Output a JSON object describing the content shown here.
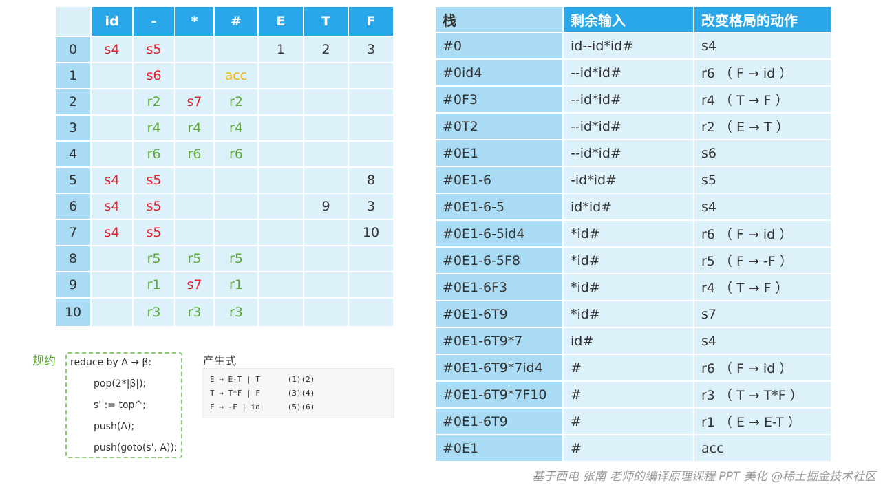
{
  "lr_table": {
    "headers": [
      "id",
      "-",
      "*",
      "#",
      "E",
      "T",
      "F"
    ],
    "rows": [
      {
        "state": "0",
        "cells": [
          {
            "t": "s4",
            "k": "s"
          },
          {
            "t": "s5",
            "k": "s"
          },
          {
            "t": "",
            "k": ""
          },
          {
            "t": "",
            "k": ""
          },
          {
            "t": "1",
            "k": "g"
          },
          {
            "t": "2",
            "k": "g"
          },
          {
            "t": "3",
            "k": "g"
          }
        ]
      },
      {
        "state": "1",
        "cells": [
          {
            "t": "",
            "k": ""
          },
          {
            "t": "s6",
            "k": "s"
          },
          {
            "t": "",
            "k": ""
          },
          {
            "t": "acc",
            "k": "a"
          },
          {
            "t": "",
            "k": ""
          },
          {
            "t": "",
            "k": ""
          },
          {
            "t": "",
            "k": ""
          }
        ]
      },
      {
        "state": "2",
        "cells": [
          {
            "t": "",
            "k": ""
          },
          {
            "t": "r2",
            "k": "r"
          },
          {
            "t": "s7",
            "k": "s"
          },
          {
            "t": "r2",
            "k": "r"
          },
          {
            "t": "",
            "k": ""
          },
          {
            "t": "",
            "k": ""
          },
          {
            "t": "",
            "k": ""
          }
        ]
      },
      {
        "state": "3",
        "cells": [
          {
            "t": "",
            "k": ""
          },
          {
            "t": "r4",
            "k": "r"
          },
          {
            "t": "r4",
            "k": "r"
          },
          {
            "t": "r4",
            "k": "r"
          },
          {
            "t": "",
            "k": ""
          },
          {
            "t": "",
            "k": ""
          },
          {
            "t": "",
            "k": ""
          }
        ]
      },
      {
        "state": "4",
        "cells": [
          {
            "t": "",
            "k": ""
          },
          {
            "t": "r6",
            "k": "r"
          },
          {
            "t": "r6",
            "k": "r"
          },
          {
            "t": "r6",
            "k": "r"
          },
          {
            "t": "",
            "k": ""
          },
          {
            "t": "",
            "k": ""
          },
          {
            "t": "",
            "k": ""
          }
        ]
      },
      {
        "state": "5",
        "cells": [
          {
            "t": "s4",
            "k": "s"
          },
          {
            "t": "s5",
            "k": "s"
          },
          {
            "t": "",
            "k": ""
          },
          {
            "t": "",
            "k": ""
          },
          {
            "t": "",
            "k": ""
          },
          {
            "t": "",
            "k": ""
          },
          {
            "t": "8",
            "k": "g"
          }
        ]
      },
      {
        "state": "6",
        "cells": [
          {
            "t": "s4",
            "k": "s"
          },
          {
            "t": "s5",
            "k": "s"
          },
          {
            "t": "",
            "k": ""
          },
          {
            "t": "",
            "k": ""
          },
          {
            "t": "",
            "k": ""
          },
          {
            "t": "9",
            "k": "g"
          },
          {
            "t": "3",
            "k": "g"
          }
        ]
      },
      {
        "state": "7",
        "cells": [
          {
            "t": "s4",
            "k": "s"
          },
          {
            "t": "s5",
            "k": "s"
          },
          {
            "t": "",
            "k": ""
          },
          {
            "t": "",
            "k": ""
          },
          {
            "t": "",
            "k": ""
          },
          {
            "t": "",
            "k": ""
          },
          {
            "t": "10",
            "k": "g"
          }
        ]
      },
      {
        "state": "8",
        "cells": [
          {
            "t": "",
            "k": ""
          },
          {
            "t": "r5",
            "k": "r"
          },
          {
            "t": "r5",
            "k": "r"
          },
          {
            "t": "r5",
            "k": "r"
          },
          {
            "t": "",
            "k": ""
          },
          {
            "t": "",
            "k": ""
          },
          {
            "t": "",
            "k": ""
          }
        ]
      },
      {
        "state": "9",
        "cells": [
          {
            "t": "",
            "k": ""
          },
          {
            "t": "r1",
            "k": "r"
          },
          {
            "t": "s7",
            "k": "s"
          },
          {
            "t": "r1",
            "k": "r"
          },
          {
            "t": "",
            "k": ""
          },
          {
            "t": "",
            "k": ""
          },
          {
            "t": "",
            "k": ""
          }
        ]
      },
      {
        "state": "10",
        "cells": [
          {
            "t": "",
            "k": ""
          },
          {
            "t": "r3",
            "k": "r"
          },
          {
            "t": "r3",
            "k": "r"
          },
          {
            "t": "r3",
            "k": "r"
          },
          {
            "t": "",
            "k": ""
          },
          {
            "t": "",
            "k": ""
          },
          {
            "t": "",
            "k": ""
          }
        ]
      }
    ]
  },
  "trace_table": {
    "headers": [
      "栈",
      "剩余输入",
      "改变格局的动作"
    ],
    "rows": [
      [
        "#0",
        "id--id*id#",
        "s4"
      ],
      [
        "#0id4",
        "--id*id#",
        "r6 （ F → id ）"
      ],
      [
        "#0F3",
        "--id*id#",
        "r4 （ T → F ）"
      ],
      [
        "#0T2",
        "--id*id#",
        "r2 （ E → T ）"
      ],
      [
        "#0E1",
        "--id*id#",
        "s6"
      ],
      [
        "#0E1-6",
        "-id*id#",
        "s5"
      ],
      [
        "#0E1-6-5",
        "id*id#",
        "s4"
      ],
      [
        "#0E1-6-5id4",
        "*id#",
        "r6 （ F → id ）"
      ],
      [
        "#0E1-6-5F8",
        "*id#",
        "r5 （ F → -F ）"
      ],
      [
        "#0E1-6F3",
        "*id#",
        "r4 （ T → F ）"
      ],
      [
        "#0E1-6T9",
        "*id#",
        "s7"
      ],
      [
        "#0E1-6T9*7",
        "id#",
        "s4"
      ],
      [
        "#0E1-6T9*7id4",
        "#",
        "r6 （ F → id ）"
      ],
      [
        "#0E1-6T9*7F10",
        "#",
        "r3 （ T → T*F ）"
      ],
      [
        "#0E1-6T9",
        "#",
        "r1 （ E → E-T ）"
      ],
      [
        "#0E1",
        "#",
        "acc"
      ]
    ]
  },
  "reduce": {
    "label": "规约",
    "lines": [
      "reduce by A → β:",
      "pop(2*|β|);",
      "s' := top^;",
      "push(A);",
      "push(goto(s', A));"
    ]
  },
  "productions": {
    "title": "产生式",
    "lines": [
      "E → E-T | T      (1)(2)",
      "T → T*F | F      (3)(4)",
      "F → -F | id      (5)(6)"
    ]
  },
  "watermark": "基于西电 张南 老师的编译原理课程 PPT 美化 @稀土掘金技术社区",
  "colors": {
    "header_blue": "#2aa7e8",
    "cell_light": "#ddf1fb",
    "cell_mid": "#a9dcf4",
    "shift_red": "#e8202a",
    "reduce_green": "#5aa831",
    "accept_yellow": "#f5b400"
  }
}
